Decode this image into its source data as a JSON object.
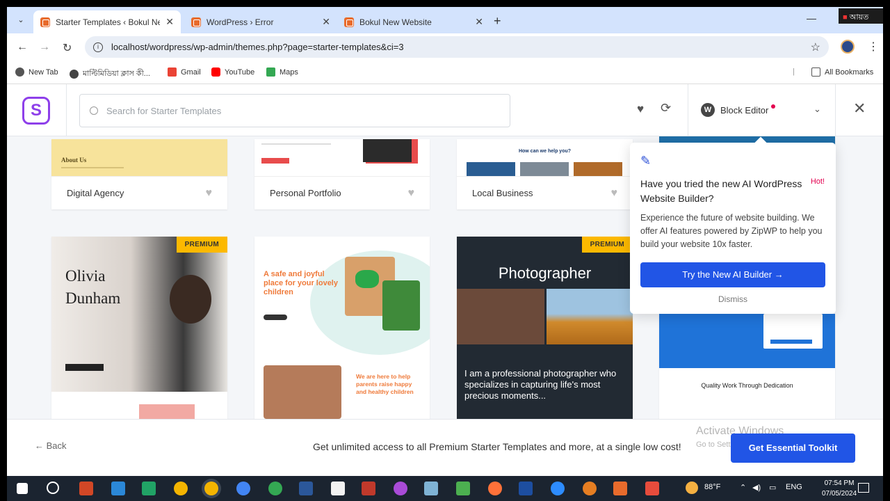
{
  "browser": {
    "tabs": [
      {
        "title": "Starter Templates ‹ Bokul New W"
      },
      {
        "title": "WordPress › Error"
      },
      {
        "title": "Bokul New Website"
      }
    ],
    "url": "localhost/wordpress/wp-admin/themes.php?page=starter-templates&ci=3",
    "bookmarks": [
      "New Tab",
      "মাল্টিমিডিয়া ক্লাস কী...",
      "Gmail",
      "YouTube",
      "Maps"
    ],
    "all_bookmarks": "All Bookmarks"
  },
  "app": {
    "search_placeholder": "Search for Starter Templates",
    "editor": "Block Editor"
  },
  "templates": {
    "row1": [
      "Digital Agency",
      "Personal Portfolio",
      "Local Business"
    ],
    "premium_badge": "PREMIUM",
    "thumb_texts": {
      "about_us": "About Us",
      "help": "How can we help you?",
      "olivia": "Olivia",
      "dunham": "Dunham",
      "kids_heading": "A safe and joyful place for your lovely children",
      "kids_sub": "We are here to help parents raise happy and healthy children",
      "photographer": "Photographer",
      "photographer_bio": "I am a professional photographer who specializes in capturing life's most precious moments...",
      "quality": "Quality Work Through Dedication"
    }
  },
  "popover": {
    "hot": "Hot!",
    "title": "Have you tried the new AI WordPress Website Builder?",
    "body": "Experience the future of website building. We offer AI features powered by ZipWP to help you build your website 10x faster.",
    "cta": "Try the New AI Builder →",
    "dismiss": "Dismiss"
  },
  "footer": {
    "back": "Back",
    "promo": "Get unlimited access to all Premium Starter Templates and more, at a single low cost!",
    "cta": "Get Essential Toolkit",
    "watermark_title": "Activate Windows",
    "watermark_sub": "Go to Settings to activate Windows."
  },
  "taskbar": {
    "weather": "88°F",
    "lang": "ENG",
    "time": "07:54 PM",
    "date": "07/05/2024"
  }
}
